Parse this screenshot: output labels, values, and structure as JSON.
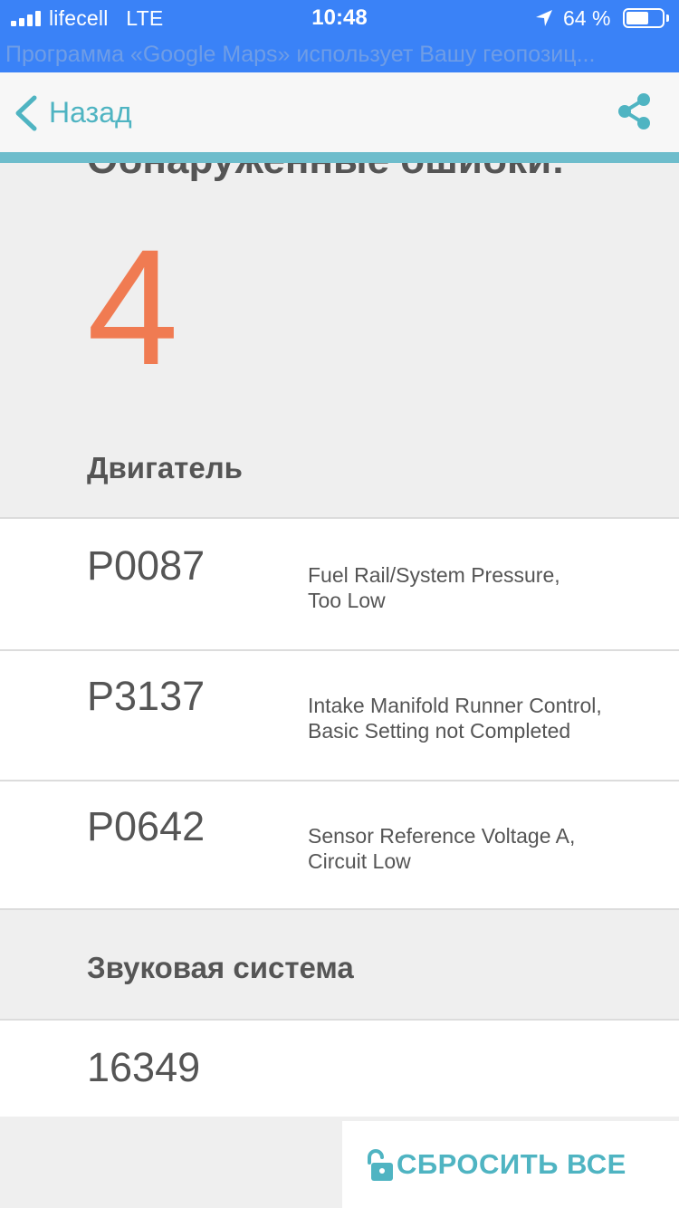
{
  "status_bar": {
    "carrier": "lifecell",
    "network": "LTE",
    "time": "10:48",
    "battery_percent": "64 %",
    "battery_level": 0.64,
    "location_banner": "Программа «Google Maps» использует Вашу геопозиц..."
  },
  "nav": {
    "back_label": "Назад",
    "back_icon": "chevron-left-icon",
    "share_icon": "share-icon"
  },
  "summary": {
    "title": "Обнаруженные ошибки:",
    "count": "4"
  },
  "sections": [
    {
      "title": "Двигатель",
      "codes": [
        {
          "code": "P0087",
          "line1": "Fuel Rail/System Pressure,",
          "line2": "Too Low"
        },
        {
          "code": "P3137",
          "line1": "Intake Manifold Runner Control,",
          "line2": "Basic Setting not Completed"
        },
        {
          "code": "P0642",
          "line1": "Sensor Reference Voltage A,",
          "line2": "Circuit Low"
        }
      ]
    },
    {
      "title": "Звуковая система",
      "codes": [
        {
          "code": "16349",
          "line1": "",
          "line2": ""
        }
      ]
    }
  ],
  "actions": {
    "reset_label": "СБРОСИТЬ ВСЕ",
    "reset_icon": "unlock-icon"
  },
  "colors": {
    "status_bar_bg": "#3a82f7",
    "accent": "#4fb4c2",
    "count": "#f07b52"
  }
}
